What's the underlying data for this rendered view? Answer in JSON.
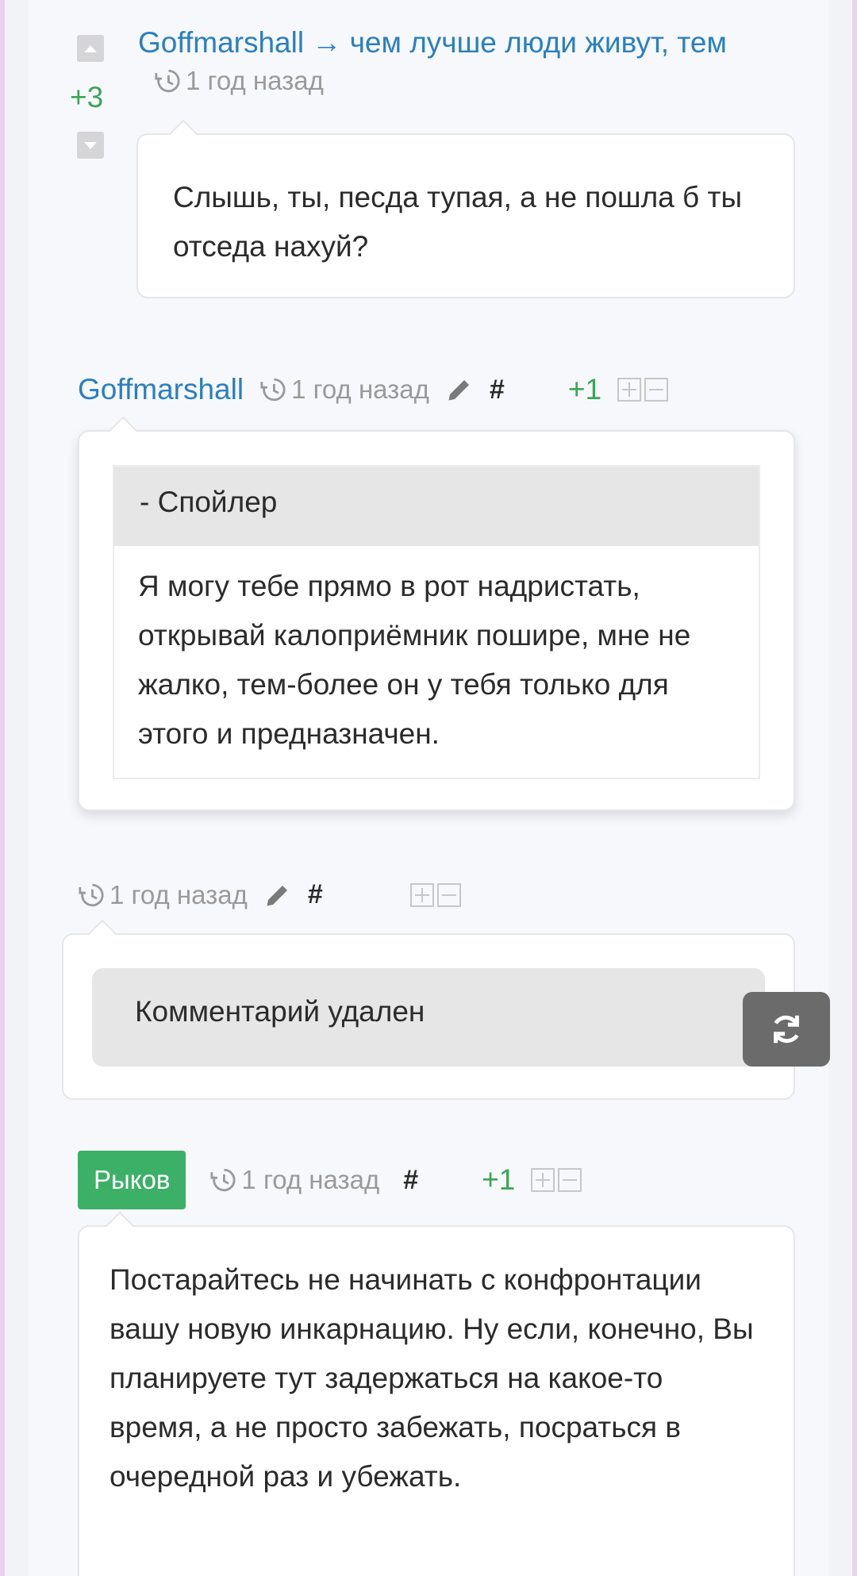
{
  "comment1": {
    "score": "+3",
    "author": "Goffmarshall",
    "arrow": "→",
    "reply_to": "чем лучше люди живут, тем",
    "time": "1 год назад",
    "text": "Слышь, ты, песда тупая, а не пошла б ты отседа нахуй?"
  },
  "comment2": {
    "author": "Goffmarshall",
    "time": "1 год назад",
    "hash": "#",
    "score": "+1",
    "spoiler_label": "- Спойлер",
    "text": "Я могу тебе прямо в рот надристать, открывай калоприёмник пошире, мне не жалко, тем-более он у тебя только для этого и предназначен."
  },
  "comment3": {
    "time": "1 год назад",
    "hash": "#",
    "deleted_text": "Комментарий удален"
  },
  "comment4": {
    "author": "Рыков",
    "time": "1 год назад",
    "hash": "#",
    "score": "+1",
    "text": "Постарайтесь не начинать с конфронтации вашу новую инкарнацию. Ну если, конечно, Вы планируете тут задержаться на какое-то время, а не просто забежать, посраться в очередной раз и убежать."
  },
  "icons": {
    "time": "history-clock-icon",
    "edit": "pencil-icon",
    "refresh": "refresh-icon",
    "expand": "expand-icon",
    "collapse": "collapse-icon",
    "upvote": "upvote-icon",
    "downvote": "downvote-icon"
  },
  "colors": {
    "link": "#2a7fc1",
    "positive": "#3aa655",
    "badge": "#3cb067",
    "muted": "#9a9a9a",
    "spoiler_header": "#e6e6e6"
  }
}
